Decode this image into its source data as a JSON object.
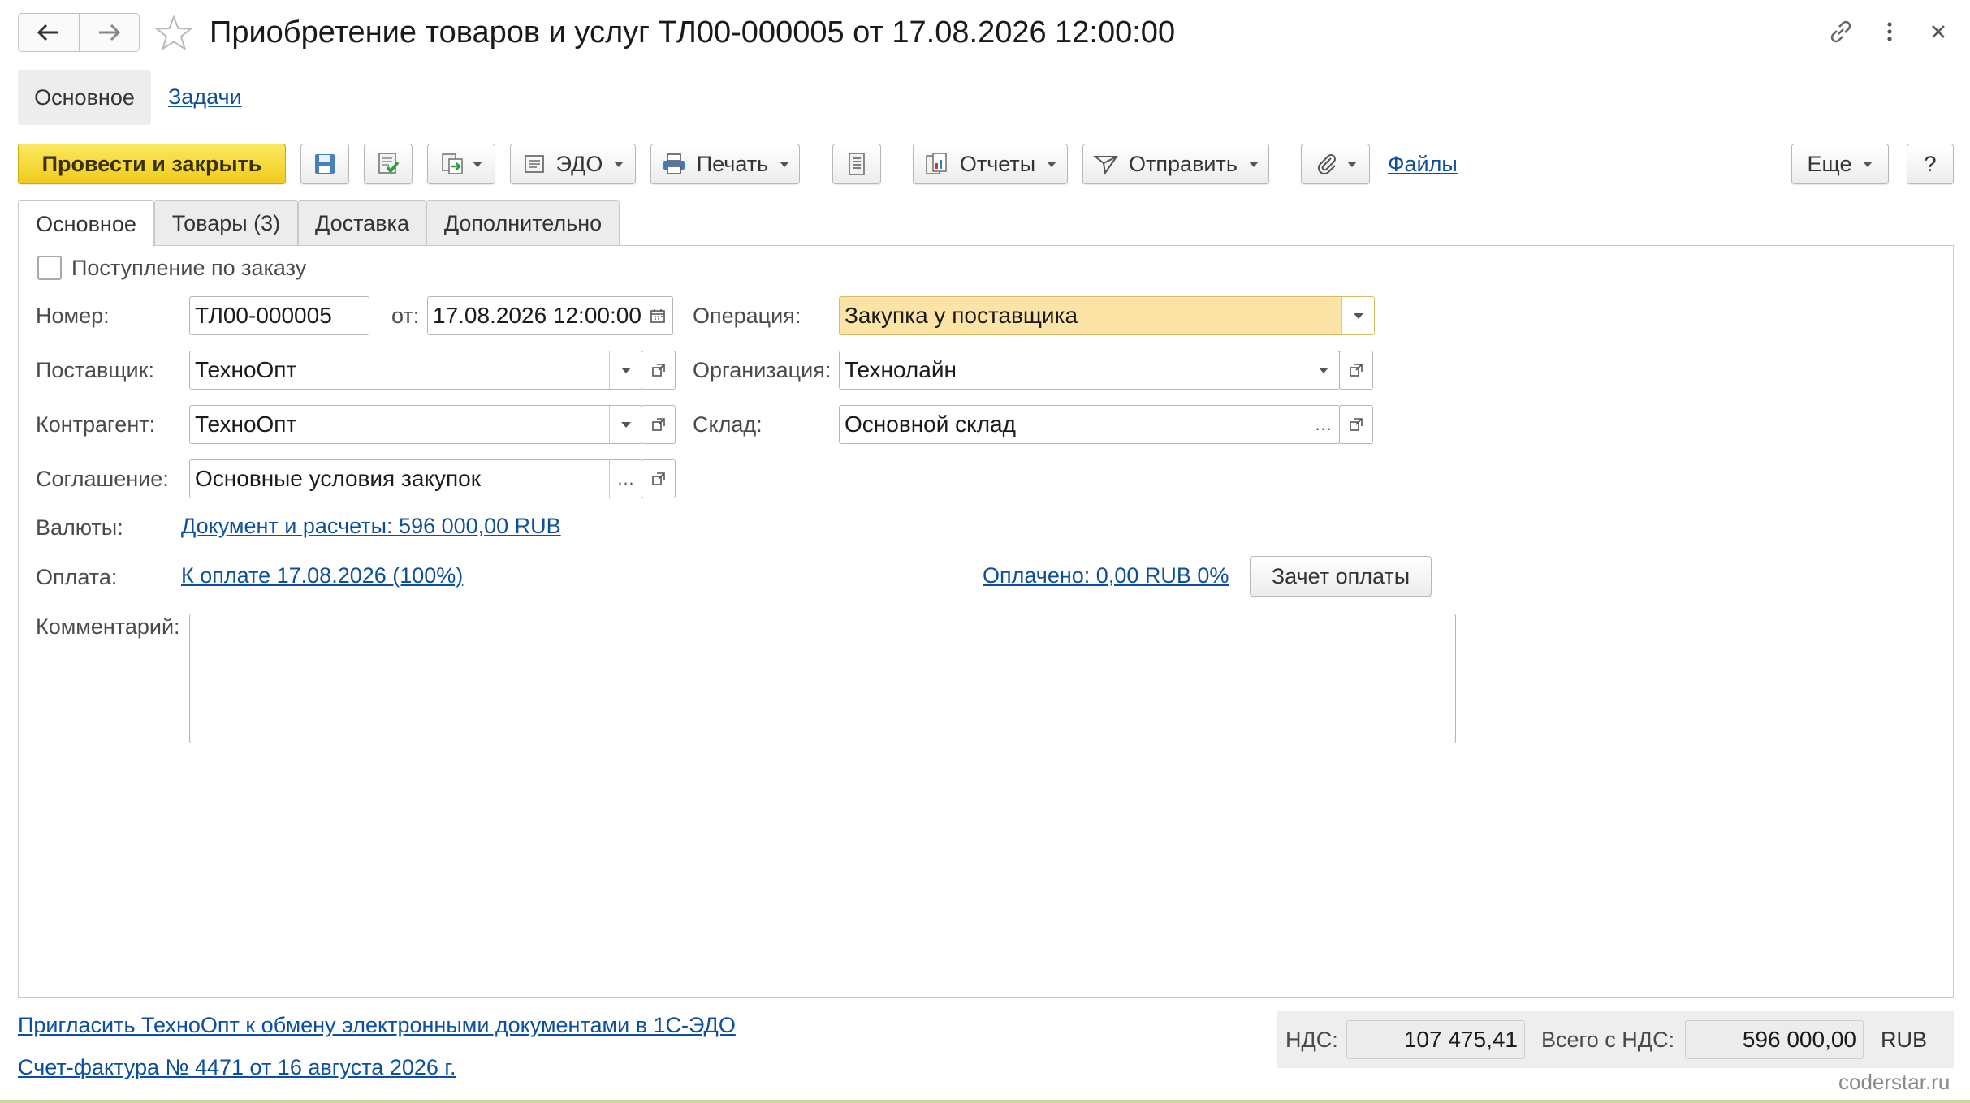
{
  "window": {
    "title": "Приобретение товаров и услуг ТЛ00-000005 от 17.08.2026 12:00:00"
  },
  "sections": {
    "main": "Основное",
    "tasks": "Задачи"
  },
  "toolbar": {
    "post_close": "Провести и закрыть",
    "edo": "ЭДО",
    "print": "Печать",
    "reports": "Отчеты",
    "send": "Отправить",
    "files": "Файлы",
    "more": "Еще",
    "help": "?"
  },
  "tabs": [
    {
      "label": "Основное",
      "active": true
    },
    {
      "label": "Товары (3)",
      "active": false
    },
    {
      "label": "Доставка",
      "active": false
    },
    {
      "label": "Дополнительно",
      "active": false
    }
  ],
  "form": {
    "by_order_label": "Поступление по заказу",
    "by_order_checked": false,
    "number_label": "Номер:",
    "number_value": "ТЛ00-000005",
    "date_label": "от:",
    "date_value": "17.08.2026 12:00:00",
    "operation_label": "Операция:",
    "operation_value": "Закупка у поставщика",
    "supplier_label": "Поставщик:",
    "supplier_value": "ТехноОпт",
    "organization_label": "Организация:",
    "organization_value": "Технолайн",
    "counterparty_label": "Контрагент:",
    "counterparty_value": "ТехноОпт",
    "warehouse_label": "Склад:",
    "warehouse_value": "Основной склад",
    "agreement_label": "Соглашение:",
    "agreement_value": "Основные условия закупок",
    "currency_label": "Валюты:",
    "currency_link": "Документ и расчеты: 596 000,00 RUB",
    "payment_label": "Оплата:",
    "payment_link": "К оплате 17.08.2026 (100%)",
    "paid_link": "Оплачено: 0,00 RUB 0%",
    "offset_button": "Зачет оплаты",
    "comment_label": "Комментарий:",
    "comment_value": ""
  },
  "footer": {
    "invite_link": "Пригласить ТехноОпт к обмену электронными документами в 1С-ЭДО",
    "invoice_link": "Счет-фактура № 4471 от 16 августа 2026 г.",
    "vat_label": "НДС:",
    "vat_value": "107 475,41",
    "total_label": "Всего с НДС:",
    "total_value": "596 000,00",
    "currency": "RUB",
    "watermark": "coderstar.ru"
  },
  "colors": {
    "primary_button": "#f4d52a",
    "operation_highlight": "#fce3a6",
    "link": "#0c4f9e"
  }
}
